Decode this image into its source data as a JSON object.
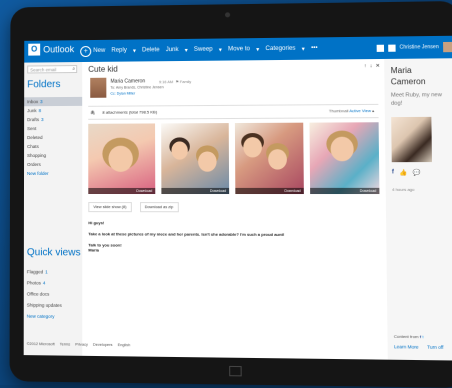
{
  "app": {
    "name": "Outlook",
    "logo": "O"
  },
  "toolbar": {
    "new": "New",
    "reply": "Reply",
    "delete": "Delete",
    "junk": "Junk",
    "sweep": "Sweep",
    "move_to": "Move to",
    "categories": "Categories",
    "more": "•••"
  },
  "user": {
    "name": "Christine Jensen"
  },
  "search": {
    "placeholder": "Search email"
  },
  "folders": {
    "heading": "Folders",
    "items": [
      {
        "label": "Inbox",
        "count": "3"
      },
      {
        "label": "Junk",
        "count": "8"
      },
      {
        "label": "Drafts",
        "count": "3"
      },
      {
        "label": "Sent",
        "count": ""
      },
      {
        "label": "Deleted",
        "count": ""
      },
      {
        "label": "Chats",
        "count": ""
      },
      {
        "label": "Shopping",
        "count": ""
      },
      {
        "label": "Orders",
        "count": ""
      },
      {
        "label": "New folder",
        "count": ""
      }
    ]
  },
  "quick_views": {
    "heading": "Quick views",
    "items": [
      {
        "label": "Flagged",
        "count": "1"
      },
      {
        "label": "Photos",
        "count": "4"
      },
      {
        "label": "Office docs",
        "count": ""
      },
      {
        "label": "Shipping updates",
        "count": ""
      },
      {
        "label": "New category",
        "count": ""
      }
    ]
  },
  "message": {
    "subject": "Cute kid",
    "sender": "Maria Cameron",
    "date": "9:16 AM",
    "tag": "Family",
    "to": "To: Amy Brands, Christine Jensen",
    "cc": "Cc: Dylan Miller",
    "attachments_label": "8 attachments (total 798.5 KB)",
    "view_label": "Thumbnail",
    "view_active": "Active View",
    "download": "Download",
    "slideshow": "View slide show (8)",
    "download_all": "Download as zip",
    "body": [
      "Hi guys!",
      "Take a look at these pictures of my niece and her parents. Isn't she adorable? I'm such a proud aunt!",
      "Talk to you soon!",
      "Maria"
    ]
  },
  "contact": {
    "first": "Maria",
    "last": "Cameron",
    "status": "Meet Ruby, my new dog!",
    "time": "4 hours ago",
    "content_from": "Content from",
    "learn_more": "Learn More",
    "turn_off": "Turn off"
  },
  "footer": [
    "©2012 Microsoft",
    "Terms",
    "Privacy",
    "Developers",
    "English"
  ],
  "colors": {
    "accent": "#0072c6"
  }
}
